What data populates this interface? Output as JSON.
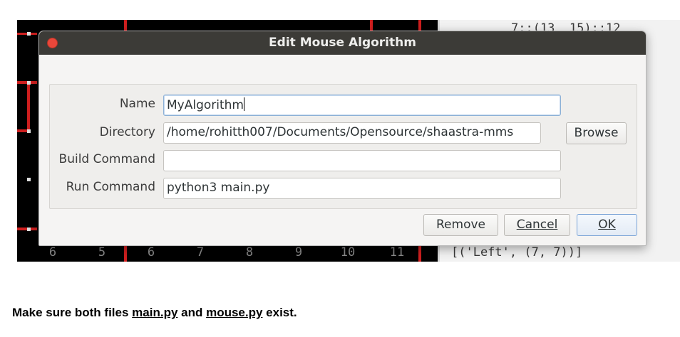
{
  "background": {
    "maze_numbers": [
      "6",
      "5",
      "6",
      "7",
      "8",
      "9",
      "10",
      "11"
    ],
    "console_top_line": "7::(13  15)::12",
    "console_line": "[('Left', (7, 7))]"
  },
  "dialog": {
    "title": "Edit Mouse Algorithm",
    "fields": {
      "name_label": "Name",
      "name_value": "MyAlgorithm",
      "directory_label": "Directory",
      "directory_value": "/home/rohitth007/Documents/Opensource/shaastra-mms",
      "build_label": "Build Command",
      "build_value": "",
      "run_label": "Run Command",
      "run_value": "python3 main.py"
    },
    "buttons": {
      "browse": "Browse",
      "remove": "Remove",
      "cancel": "Cancel",
      "ok": "OK"
    }
  },
  "caption": {
    "prefix": "Make sure both files ",
    "file1": "main.py",
    "middle": " and ",
    "file2": "mouse.py",
    "suffix": " exist."
  },
  "colors": {
    "titlebar": "#3c3b37",
    "close_button": "#e9473a",
    "wall": "#cf1f1f",
    "default_button_border": "#7aa3d6"
  }
}
